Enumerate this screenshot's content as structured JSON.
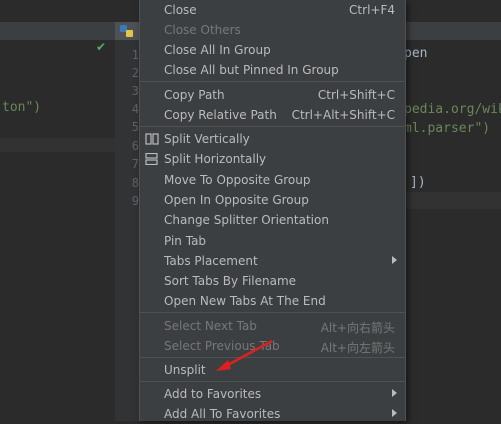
{
  "left_editor": {
    "code_line": "ton\")"
  },
  "right_editor": {
    "line_numbers": [
      "1",
      "2",
      "3",
      "4",
      "5",
      "6",
      "7",
      "8",
      "9"
    ],
    "code": {
      "line1": "pen",
      "line4": "pedia.org/wik",
      "line5": "ml.parser\")",
      "line8": "])"
    }
  },
  "menu": {
    "close": {
      "label": "Close",
      "shortcut": "Ctrl+F4"
    },
    "close_others": {
      "label": "Close Others"
    },
    "close_all_in_group": {
      "label": "Close All In Group"
    },
    "close_all_but_pinned": {
      "label": "Close All but Pinned In Group"
    },
    "copy_path": {
      "label": "Copy Path",
      "shortcut": "Ctrl+Shift+C"
    },
    "copy_relative_path": {
      "label": "Copy Relative Path",
      "shortcut": "Ctrl+Alt+Shift+C"
    },
    "split_vertically": {
      "label": "Split Vertically"
    },
    "split_horizontally": {
      "label": "Split Horizontally"
    },
    "move_to_opposite_group": {
      "label": "Move To Opposite Group"
    },
    "open_in_opposite_group": {
      "label": "Open In Opposite Group"
    },
    "change_splitter_orientation": {
      "label": "Change Splitter Orientation"
    },
    "pin_tab": {
      "label": "Pin Tab"
    },
    "tabs_placement": {
      "label": "Tabs Placement"
    },
    "sort_tabs_by_filename": {
      "label": "Sort Tabs By Filename"
    },
    "open_new_tabs_at_end": {
      "label": "Open New Tabs At The End"
    },
    "select_next_tab": {
      "label": "Select Next Tab",
      "shortcut": "Alt+向右箭头"
    },
    "select_previous_tab": {
      "label": "Select Previous Tab",
      "shortcut": "Alt+向左箭头"
    },
    "unsplit": {
      "label": "Unsplit"
    },
    "add_to_favorites": {
      "label": "Add to Favorites"
    },
    "add_all_to_favorites": {
      "label": "Add All To Favorites"
    }
  },
  "colors": {
    "background": "#2b2b2b",
    "menu_background": "#3c3f41",
    "menu_text": "#bbbbbb",
    "disabled_text": "#777777",
    "annotation_arrow": "#e02020"
  }
}
